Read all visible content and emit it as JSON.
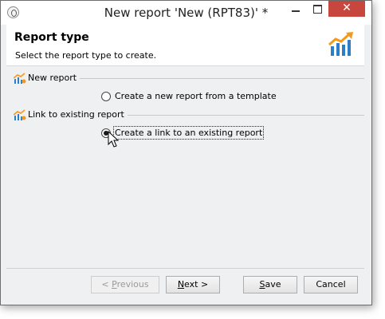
{
  "window": {
    "title": "New report 'New (RPT83)' *",
    "controls": {
      "minimize": "—",
      "maximize": "□",
      "close": "✕"
    }
  },
  "header": {
    "title": "Report type",
    "subtitle": "Select the report type to create."
  },
  "groups": [
    {
      "label": "New report",
      "icon": "report-chart-icon",
      "options": [
        {
          "label": "Create a new report from a template",
          "checked": false
        }
      ]
    },
    {
      "label": "Link to existing report",
      "icon": "report-chart-icon",
      "options": [
        {
          "label": "Create a link to an existing report",
          "checked": true
        }
      ]
    }
  ],
  "buttons": {
    "previous": {
      "prefix": "< ",
      "mnemonic": "P",
      "rest": "revious",
      "enabled": false
    },
    "next": {
      "mnemonic": "N",
      "rest": "ext >",
      "enabled": true
    },
    "save": {
      "mnemonic": "S",
      "rest": "ave",
      "enabled": true
    },
    "cancel": {
      "label": "Cancel",
      "enabled": true
    }
  },
  "colors": {
    "accent_orange": "#f39a1d",
    "accent_blue": "#2d7ec4",
    "close_red": "#c7463d"
  }
}
